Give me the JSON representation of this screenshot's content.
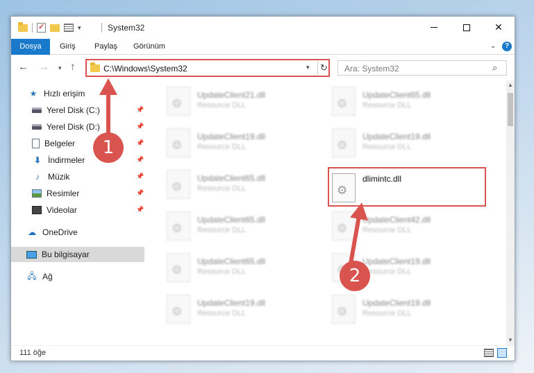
{
  "window": {
    "title": "System32"
  },
  "titlebar": {
    "quick_access_dropdown": "▾",
    "minimize": "—",
    "maximize": "☐",
    "close": "✕"
  },
  "ribbon": {
    "tabs": [
      "Dosya",
      "Giriş",
      "Paylaş",
      "Görünüm"
    ],
    "accent": "#1979ca",
    "help": "?"
  },
  "address_bar": {
    "path": "C:\\Windows\\System32",
    "back": "←",
    "forward": "→",
    "recent": "▾",
    "up": "↑",
    "refresh": "↻"
  },
  "search": {
    "placeholder": "Ara: System32",
    "icon": "search-icon"
  },
  "sidebar": {
    "items": [
      {
        "label": "Hızlı erişim",
        "icon": "star-icon",
        "pinned": false
      },
      {
        "label": "Yerel Disk (C:)",
        "icon": "disk-icon",
        "pinned": true
      },
      {
        "label": "Yerel Disk (D:)",
        "icon": "disk-icon",
        "pinned": true
      },
      {
        "label": "Belgeler",
        "icon": "documents-icon",
        "pinned": true
      },
      {
        "label": "İndirmeler",
        "icon": "downloads-icon",
        "pinned": true
      },
      {
        "label": "Müzik",
        "icon": "music-icon",
        "pinned": true
      },
      {
        "label": "Resimler",
        "icon": "pictures-icon",
        "pinned": true
      },
      {
        "label": "Videolar",
        "icon": "videos-icon",
        "pinned": true
      },
      {
        "label": "OneDrive",
        "icon": "cloud-icon",
        "pinned": false
      },
      {
        "label": "Bu bilgisayar",
        "icon": "computer-icon",
        "pinned": false,
        "selected": true
      },
      {
        "label": "Ağ",
        "icon": "network-icon",
        "pinned": false
      }
    ]
  },
  "files": [
    {
      "name": "UpdateClient21.dll",
      "desc": "Resource DLL"
    },
    {
      "name": "UpdateClient65.dll",
      "desc": "Resource DLL"
    },
    {
      "name": "UpdateClient19.dll",
      "desc": "Resource DLL"
    },
    {
      "name": "UpdateClient19.dll",
      "desc": "Resource DLL"
    },
    {
      "name": "UpdateClient65.dll",
      "desc": "Resource DLL"
    },
    {
      "name": "dlimintc.dll",
      "desc": "",
      "highlighted": true
    },
    {
      "name": "UpdateClient65.dll",
      "desc": "Resource DLL"
    },
    {
      "name": "UpdateClient42.dll",
      "desc": "Resource DLL"
    },
    {
      "name": "UpdateClient65.dll",
      "desc": "Resource DLL"
    },
    {
      "name": "UpdateClient19.dll",
      "desc": "Resource DLL"
    },
    {
      "name": "UpdateClient19.dll",
      "desc": "Resource DLL"
    },
    {
      "name": "UpdateClient19.dll",
      "desc": "Resource DLL"
    }
  ],
  "status": {
    "count": "111 öğe"
  },
  "annotations": {
    "step1": "1",
    "step2": "2",
    "color": "#d9534f"
  }
}
